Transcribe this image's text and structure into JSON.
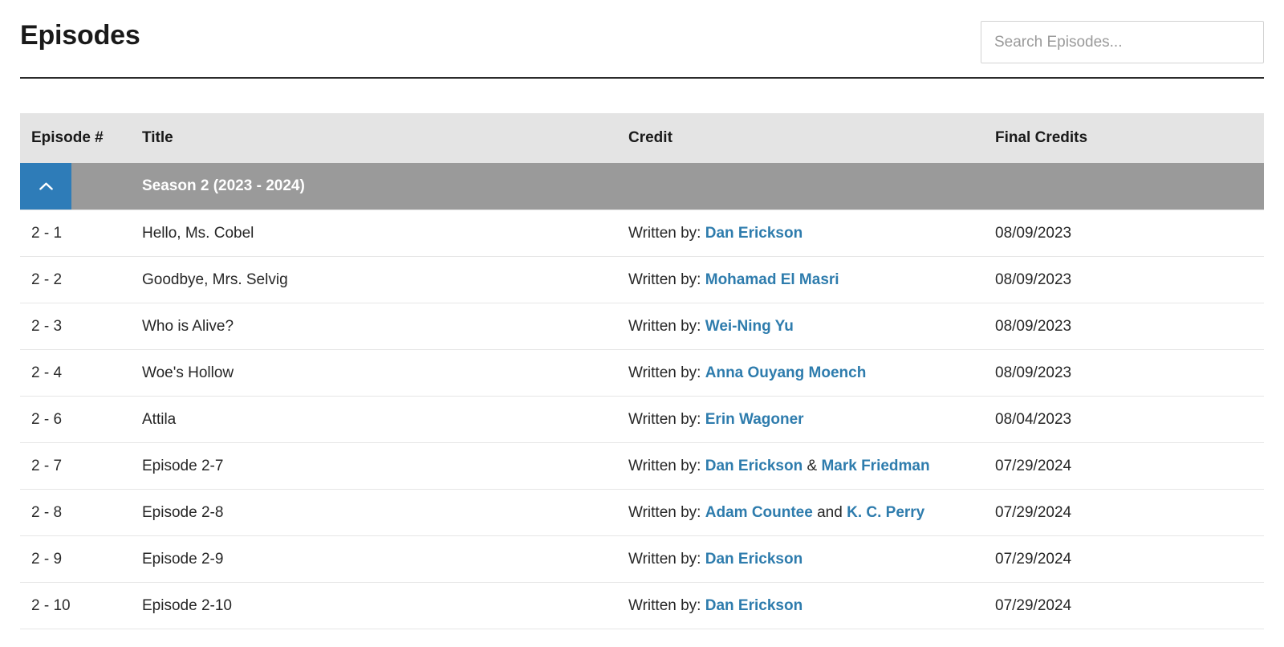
{
  "header": {
    "title": "Episodes",
    "search": {
      "placeholder": "Search Episodes...",
      "value": ""
    }
  },
  "table": {
    "columns": [
      {
        "key": "episode_number",
        "label": "Episode #"
      },
      {
        "key": "title",
        "label": "Title"
      },
      {
        "key": "credit",
        "label": "Credit"
      },
      {
        "key": "final_credits",
        "label": "Final Credits"
      }
    ],
    "season_group": {
      "label": "Season 2 (2023 - 2024)",
      "toggle_icon": "chevron-up-icon",
      "expanded": true
    },
    "rows": [
      {
        "episode_number": "2 - 1",
        "title": "Hello, Ms. Cobel",
        "credit_prefix": "Written by:",
        "writers": [
          "Dan Erickson"
        ],
        "separator": "",
        "final_credits": "08/09/2023"
      },
      {
        "episode_number": "2 - 2",
        "title": "Goodbye, Mrs. Selvig",
        "credit_prefix": "Written by:",
        "writers": [
          "Mohamad El Masri"
        ],
        "separator": "",
        "final_credits": "08/09/2023"
      },
      {
        "episode_number": "2 - 3",
        "title": "Who is Alive?",
        "credit_prefix": "Written by:",
        "writers": [
          "Wei-Ning Yu"
        ],
        "separator": "",
        "final_credits": "08/09/2023"
      },
      {
        "episode_number": "2 - 4",
        "title": "Woe's Hollow",
        "credit_prefix": "Written by:",
        "writers": [
          "Anna Ouyang Moench"
        ],
        "separator": "",
        "final_credits": "08/09/2023"
      },
      {
        "episode_number": "2 - 6",
        "title": "Attila",
        "credit_prefix": "Written by:",
        "writers": [
          "Erin Wagoner"
        ],
        "separator": "",
        "final_credits": "08/04/2023"
      },
      {
        "episode_number": "2 - 7",
        "title": "Episode 2-7",
        "credit_prefix": "Written by:",
        "writers": [
          "Dan Erickson",
          "Mark Friedman"
        ],
        "separator": "&",
        "final_credits": "07/29/2024"
      },
      {
        "episode_number": "2 - 8",
        "title": "Episode 2-8",
        "credit_prefix": "Written by:",
        "writers": [
          "Adam Countee",
          "K. C. Perry"
        ],
        "separator": "and",
        "final_credits": "07/29/2024"
      },
      {
        "episode_number": "2 - 9",
        "title": "Episode 2-9",
        "credit_prefix": "Written by:",
        "writers": [
          "Dan Erickson"
        ],
        "separator": "",
        "final_credits": "07/29/2024"
      },
      {
        "episode_number": "2 - 10",
        "title": "Episode 2-10",
        "credit_prefix": "Written by:",
        "writers": [
          "Dan Erickson"
        ],
        "separator": "",
        "final_credits": "07/29/2024"
      }
    ]
  },
  "colors": {
    "link": "#2e7cad",
    "toggle_button": "#2e7cb8",
    "header_background": "#e4e4e4",
    "group_row_background": "#9a9a9a",
    "row_border": "#e6e6e6",
    "rule": "#2b2b2b"
  }
}
